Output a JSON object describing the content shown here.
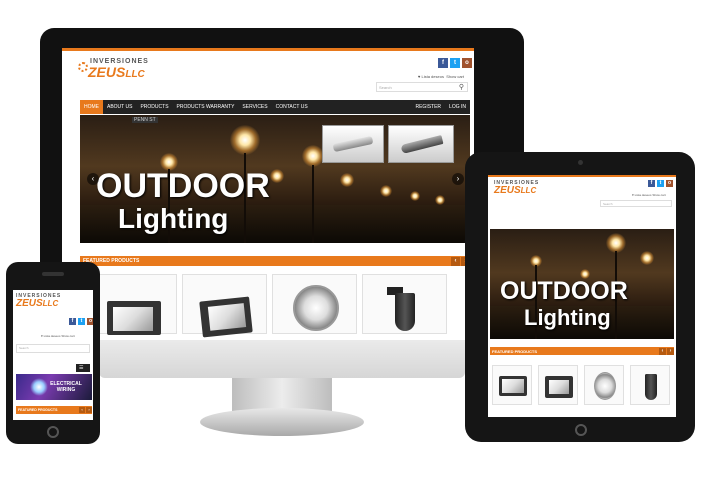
{
  "site": {
    "logo_top": "INVERSIONES",
    "logo_main": "ZEUS",
    "logo_suffix": "LLC",
    "social": [
      "f",
      "t",
      "o"
    ],
    "account": {
      "wishlist": "Lista deseos",
      "cart": "Show cart"
    },
    "search_placeholder": "Search",
    "nav": [
      "HOME",
      "ABOUT US",
      "PRODUCTS",
      "PRODUCTS WARRANTY",
      "SERVICES",
      "CONTACT US"
    ],
    "nav_right": [
      "REGISTER",
      "LOG IN"
    ],
    "street_sign": "PENN ST",
    "hero_line1": "OUTDOOR",
    "hero_line2": "Lighting",
    "featured": "FEATURED PRODUCTS",
    "accent": "#e8791c",
    "phone_banner": "ELECTRICAL WIRING"
  }
}
